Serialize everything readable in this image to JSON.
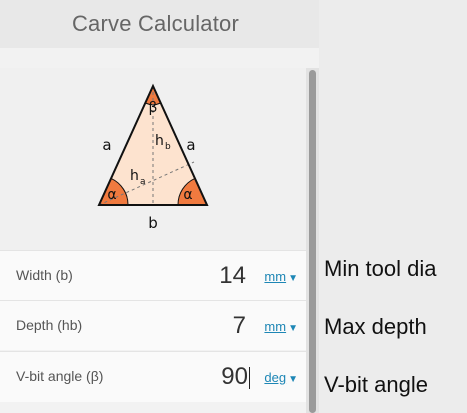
{
  "app": {
    "title": "Carve Calculator"
  },
  "diagram": {
    "apex_label": "β",
    "base_angle_left": "α",
    "base_angle_right": "α",
    "side_left": "a",
    "side_right": "a",
    "base": "b",
    "height_b_main": "h",
    "height_b_sub": "b",
    "height_a_main": "h",
    "height_a_sub": "a",
    "colors": {
      "fill": "#fde3cf",
      "angle": "#f07a3f",
      "stroke": "#111111"
    }
  },
  "fields": [
    {
      "label": "Width (b)",
      "value": "14",
      "unit": "mm",
      "side_label": "Min tool dia"
    },
    {
      "label": "Depth (hb)",
      "value": "7",
      "unit": "mm",
      "side_label": "Max depth"
    },
    {
      "label": "V-bit angle (β)",
      "value": "90",
      "unit": "deg",
      "side_label": "V-bit angle"
    }
  ]
}
